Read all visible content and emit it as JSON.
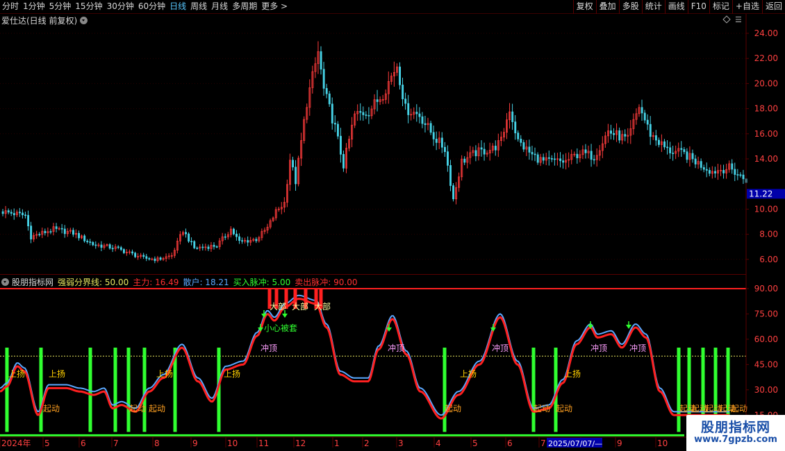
{
  "toolbar": {
    "periods": [
      "分时",
      "1分钟",
      "5分钟",
      "15分钟",
      "30分钟",
      "60分钟",
      "日线",
      "周线",
      "月线",
      "多周期",
      "更多 >"
    ],
    "active_period": "日线",
    "tools": [
      "复权",
      "叠加",
      "多股",
      "统计",
      "画线",
      "F10",
      "标记",
      "+自选",
      "返回"
    ]
  },
  "main": {
    "title": "爱仕达(日线 前复权)",
    "price_labels": [
      "24.00",
      "22.00",
      "20.00",
      "18.00",
      "16.00",
      "14.00",
      "10.00",
      "8.00",
      "6.00"
    ],
    "last_price": "11.22"
  },
  "indicator": {
    "name": "股朋指标网",
    "items": [
      {
        "label": "强弱分界线: 50.00",
        "color": "#e8e860"
      },
      {
        "label": "主力: 16.49",
        "color": "#ff3030"
      },
      {
        "label": "散户: 18.21",
        "color": "#5aa8ff"
      },
      {
        "label": "买入脉冲: 5.00",
        "color": "#30ff30"
      },
      {
        "label": "卖出脉冲: 90.00",
        "color": "#ff3030"
      }
    ],
    "value_labels": [
      "90.00",
      "75.00",
      "60.00",
      "45.00",
      "30.00",
      "15.00"
    ],
    "annotations": {
      "shangyang": "上扬",
      "qidong": "起动",
      "chongding": "冲顶",
      "dingbu": "大部",
      "xiaoxin": "小心被套"
    }
  },
  "date_axis": {
    "labels": [
      "2024年",
      "5",
      "6",
      "7",
      "8",
      "9",
      "10",
      "11",
      "12",
      "1",
      "2",
      "3",
      "4",
      "5",
      "6",
      "7",
      "8",
      "9",
      "10"
    ],
    "cursor_date": "2025/07/07/—"
  },
  "colors": {
    "up": "#ff3c3c",
    "down": "#46d2e6",
    "grid": "#5a0000",
    "axis_text": "#ff4040"
  },
  "watermark": {
    "title": "股朋指标网",
    "url": "www.7gpzb.com"
  }
}
